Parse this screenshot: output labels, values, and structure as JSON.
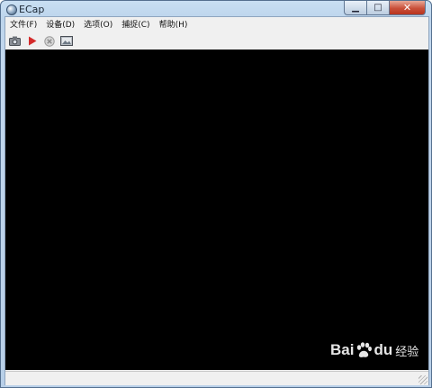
{
  "window": {
    "title": "ECap"
  },
  "window_controls": {
    "minimize": "▁",
    "maximize": "□",
    "close": "✕"
  },
  "menu": [
    {
      "label": "文件(F)"
    },
    {
      "label": "设备(D)"
    },
    {
      "label": "选项(O)"
    },
    {
      "label": "捕捉(C)"
    },
    {
      "label": "帮助(H)"
    }
  ],
  "toolbar": {
    "buttons": [
      {
        "icon": "camera-icon"
      },
      {
        "icon": "play-icon"
      },
      {
        "icon": "stop-icon"
      },
      {
        "icon": "screenshot-icon"
      }
    ]
  },
  "status": {
    "text": ""
  },
  "watermark": {
    "brand_a": "Bai",
    "brand_b": "du",
    "suffix": "经验"
  },
  "colors": {
    "video_bg": "#000000",
    "play_red": "#d42b2b",
    "chrome": "#f0f0f0"
  }
}
